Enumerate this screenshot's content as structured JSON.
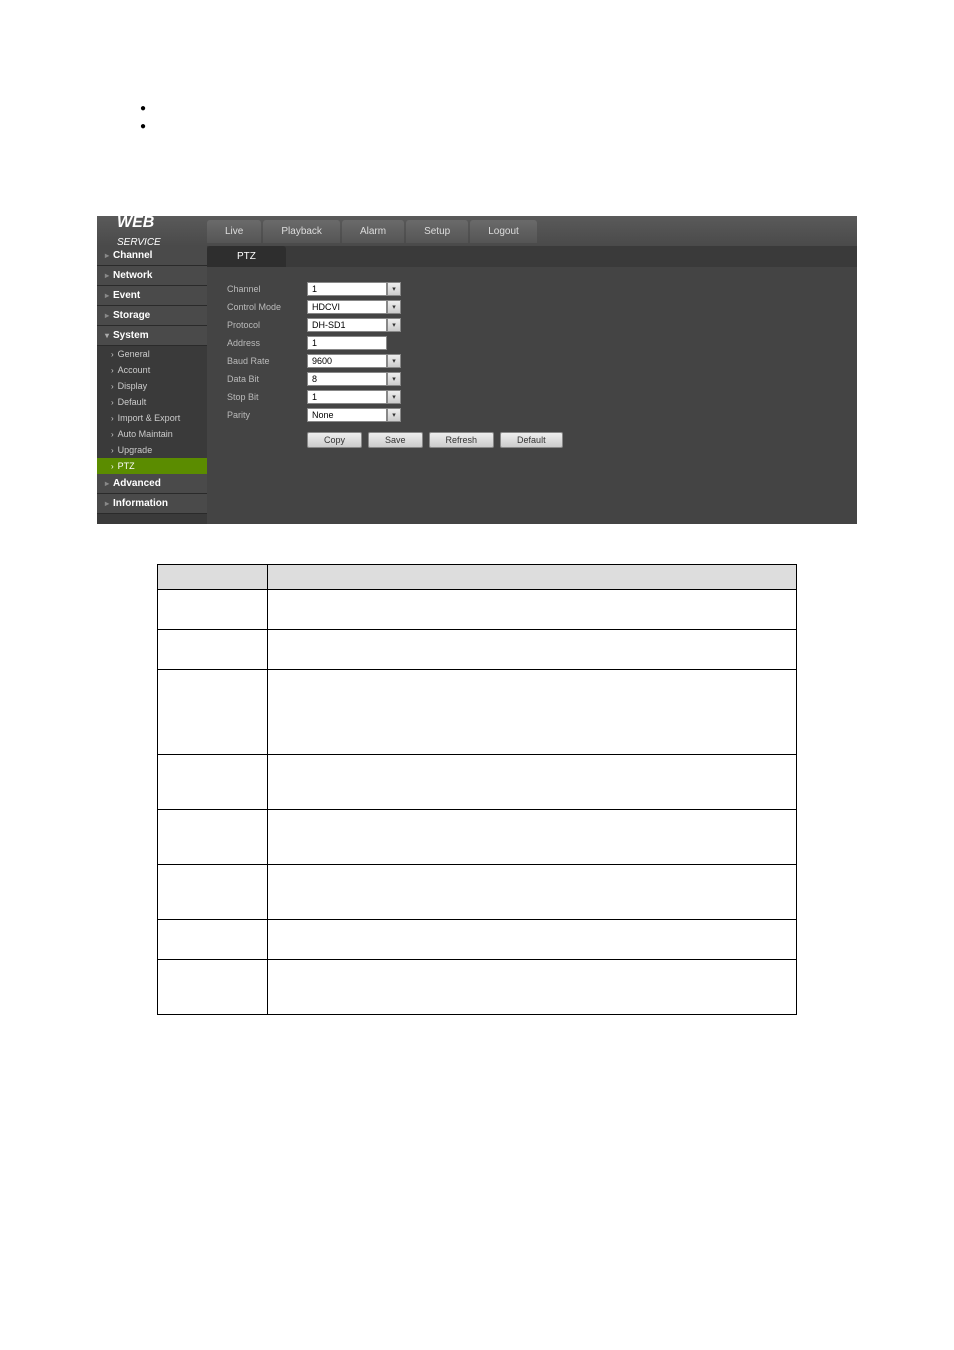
{
  "logo": {
    "bold": "WEB",
    "light": "SERVICE"
  },
  "nav": {
    "tabs": [
      "Live",
      "Playback",
      "Alarm",
      "Setup",
      "Logout"
    ]
  },
  "sidebar": {
    "sections": [
      {
        "label": "Channel",
        "expanded": false
      },
      {
        "label": "Network",
        "expanded": false
      },
      {
        "label": "Event",
        "expanded": false
      },
      {
        "label": "Storage",
        "expanded": false
      },
      {
        "label": "System",
        "expanded": true,
        "items": [
          {
            "label": "General",
            "active": false
          },
          {
            "label": "Account",
            "active": false
          },
          {
            "label": "Display",
            "active": false
          },
          {
            "label": "Default",
            "active": false
          },
          {
            "label": "Import & Export",
            "active": false
          },
          {
            "label": "Auto Maintain",
            "active": false
          },
          {
            "label": "Upgrade",
            "active": false
          },
          {
            "label": "PTZ",
            "active": true
          }
        ]
      },
      {
        "label": "Advanced",
        "expanded": false
      },
      {
        "label": "Information",
        "expanded": false
      }
    ]
  },
  "content": {
    "tab": "PTZ",
    "fields": {
      "channel": {
        "label": "Channel",
        "value": "1"
      },
      "control_mode": {
        "label": "Control Mode",
        "value": "HDCVI"
      },
      "protocol": {
        "label": "Protocol",
        "value": "DH-SD1"
      },
      "address": {
        "label": "Address",
        "value": "1"
      },
      "baud_rate": {
        "label": "Baud Rate",
        "value": "9600"
      },
      "data_bit": {
        "label": "Data Bit",
        "value": "8"
      },
      "stop_bit": {
        "label": "Stop Bit",
        "value": "1"
      },
      "parity": {
        "label": "Parity",
        "value": "None"
      }
    },
    "buttons": {
      "copy": "Copy",
      "save": "Save",
      "refresh": "Refresh",
      "default": "Default"
    }
  },
  "table": {
    "headers": {
      "param": "",
      "func": ""
    },
    "rows": [
      {
        "param": "",
        "func": "",
        "cls": "row-small"
      },
      {
        "param": "",
        "func": "",
        "cls": "row-small"
      },
      {
        "param": "",
        "func": "",
        "cls": "row-tall"
      },
      {
        "param": "",
        "func": "",
        "cls": "row-med"
      },
      {
        "param": "",
        "func": "",
        "cls": "row-med"
      },
      {
        "param": "",
        "func": "",
        "cls": "row-med"
      },
      {
        "param": "",
        "func": "",
        "cls": "row-small"
      },
      {
        "param": "",
        "func": "",
        "cls": "row-med"
      }
    ]
  }
}
